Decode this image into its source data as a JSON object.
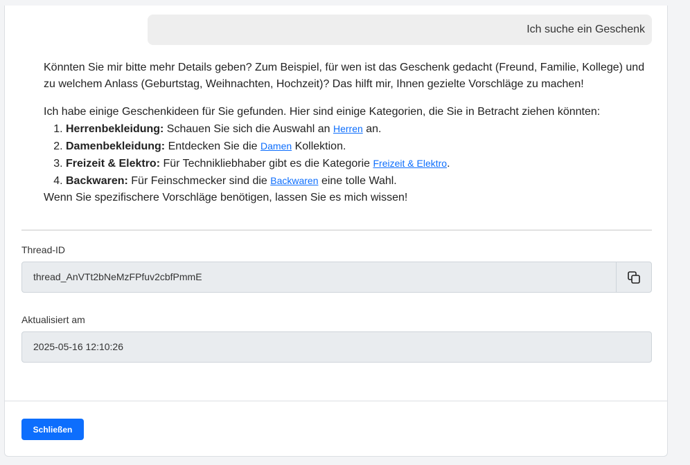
{
  "chat": {
    "user_message": "Ich suche ein Geschenk",
    "assistant_intro": "Könnten Sie mir bitte mehr Details geben? Zum Beispiel, für wen ist das Geschenk gedacht (Freund, Familie, Kollege) und zu welchem Anlass (Geburtstag, Weihnachten, Hochzeit)? Das hilft mir, Ihnen gezielte Vorschläge zu machen!",
    "assistant_lead": "Ich habe einige Geschenkideen für Sie gefunden. Hier sind einige Kategorien, die Sie in Betracht ziehen könnten:",
    "items": [
      {
        "title": "Herrenbekleidung:",
        "before": " Schauen Sie sich die Auswahl an ",
        "link": "Herren",
        "after": " an."
      },
      {
        "title": "Damenbekleidung:",
        "before": " Entdecken Sie die ",
        "link": "Damen",
        "after": " Kollektion."
      },
      {
        "title": "Freizeit & Elektro:",
        "before": " Für Technikliebhaber gibt es die Kategorie ",
        "link": "Freizeit & Elektro",
        "after": "."
      },
      {
        "title": "Backwaren:",
        "before": " Für Feinschmecker sind die ",
        "link": "Backwaren",
        "after": " eine tolle Wahl."
      }
    ],
    "assistant_outro": "Wenn Sie spezifischere Vorschläge benötigen, lassen Sie es mich wissen!"
  },
  "thread": {
    "label": "Thread-ID",
    "value": "thread_AnVTt2bNeMzFPfuv2cbfPmmE"
  },
  "updated": {
    "label": "Aktualisiert am",
    "value": "2025-05-16 12:10:26"
  },
  "footer": {
    "close_label": "Schließen"
  },
  "icons": {
    "copy": "copy-icon"
  },
  "colors": {
    "primary": "#0d6efd",
    "link": "#0d6efd",
    "field_bg": "#e9ecef"
  }
}
